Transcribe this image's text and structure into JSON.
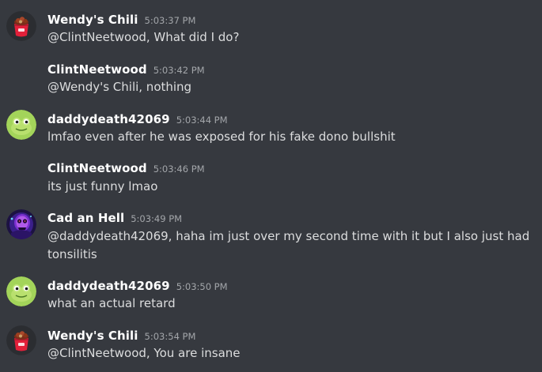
{
  "messages": [
    {
      "author": "Wendy's Chili",
      "time": "5:03:37 PM",
      "text": "@ClintNeetwood, What did I do?",
      "avatar": "chili-cup-icon"
    },
    {
      "author": "ClintNeetwood",
      "time": "5:03:42 PM",
      "text": "@Wendy's Chili, nothing",
      "avatar": null
    },
    {
      "author": "daddydeath42069",
      "time": "5:03:44 PM",
      "text": "lmfao even after he was exposed for his fake dono bullshit",
      "avatar": "green-frog-icon"
    },
    {
      "author": "ClintNeetwood",
      "time": "5:03:46 PM",
      "text": "its just funny lmao",
      "avatar": null
    },
    {
      "author": "Cad an Hell",
      "time": "5:03:49 PM",
      "text": "@daddydeath42069, haha im just over my second time with it but I also just had tonsilitis",
      "avatar": "purple-skull-icon"
    },
    {
      "author": "daddydeath42069",
      "time": "5:03:50 PM",
      "text": "what an actual retard",
      "avatar": "green-frog-icon"
    },
    {
      "author": "Wendy's Chili",
      "time": "5:03:54 PM",
      "text": "@ClintNeetwood, You are insane",
      "avatar": "chili-cup-icon"
    }
  ],
  "colors": {
    "background": "#36393f",
    "username": "#ffffff",
    "timestamp": "#a3a6aa",
    "text": "#dcddde"
  }
}
